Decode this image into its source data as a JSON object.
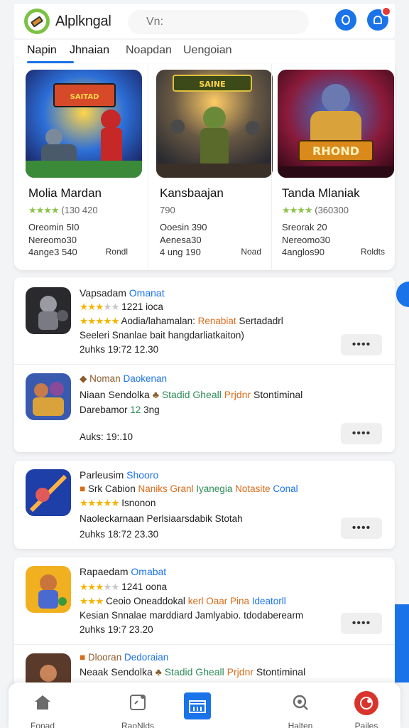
{
  "header": {
    "app_title": "Alplkngal",
    "search_placeholder": "Vn:"
  },
  "tabs": [
    {
      "label": "Napin"
    },
    {
      "label": "Jhnaian"
    },
    {
      "label": "Noapdan"
    },
    {
      "label": "Uengoian"
    }
  ],
  "featured": [
    {
      "title": "Molia Mardan",
      "rating_text": "4:4:4",
      "count": "(130 420",
      "stat1": "Oreomin 5I0",
      "stat2": "Nereomo30",
      "stat3": "4ange3 540",
      "right_label": "Rondl"
    },
    {
      "title": "Kansbaajan",
      "rating_text": "",
      "count": "790",
      "stat1": "Ooesin 390",
      "stat2": "Aenesa30",
      "stat3": "4 ung 190",
      "right_label": "Noad"
    },
    {
      "title": "Tanda Mlaniak",
      "rating_text": "3:4:4",
      "count": "(360300",
      "stat1": "Sreorak 20",
      "stat2": "Nereomo30",
      "stat3": "4anglos90",
      "right_label": "Roldts"
    }
  ],
  "featured_art": {
    "1": {
      "banner": "SAITAD"
    },
    "2": {
      "banner": "SAINE"
    },
    "3": {
      "banner": "RHOND"
    }
  },
  "list": {
    "card1": [
      {
        "title": "Vapsadam",
        "badge": "Omanat",
        "rating_count": "1221 ioca",
        "tags_a": "Aodia/lahamalan:",
        "tags_b": "Renabiat",
        "tags_c": "Sertadadrl",
        "desc": "Seeleri Snanlae bait hangdarliatkaiton)",
        "meta": "2uhks 19:72 12.30",
        "more": "••••"
      },
      {
        "title": "Noman",
        "badge": "Daokenan",
        "tag_line_a": "Niaan Sendolka",
        "tag_line_b": "Stadid Gheall",
        "tag_line_c": "Prjdnr",
        "tag_line_d": "Stontiminal",
        "sub": "Darebamor",
        "sub2": "12",
        "sub3": "3ng",
        "meta": "Auks: 19:.10",
        "more": "••••"
      }
    ],
    "card2": [
      {
        "title": "Parleusim",
        "badge": "Shooro",
        "tag_a": "Srk Cabion",
        "tag_b": "Naniks Granl",
        "tag_c": "Iyanegia",
        "tag_d": "Notasite",
        "tag_e": "Conal",
        "rating_count": "Isnonon",
        "desc": "Naoleckarnaan Perlsiaarsdabik Stotah",
        "meta": "2uhks 18:72 23.30",
        "more": "••••"
      }
    ],
    "card3": [
      {
        "title": "Rapaedam",
        "badge": "Omabat",
        "rating_count": "1241 oona",
        "tags_a": "Ceoio Oneaddokal",
        "tags_b": "kerl Oaar Pina",
        "tags_c": "Ideatorll",
        "desc": "Kesian Snnalae marddiard Jamlyabio. tdodaberearm",
        "meta": "2uhks 19:7 23.20",
        "more": "••••"
      },
      {
        "title": "Dlooran",
        "badge": "Dedoraian",
        "tag_line_a": "Neaak Sendolka",
        "tag_line_b": "Stadid Gheall",
        "tag_line_c": "Prjdnr",
        "tag_line_d": "Stontiminal"
      }
    ]
  },
  "bottom_nav": [
    {
      "label": "Fonad",
      "icon": "home-icon"
    },
    {
      "label": "RaoNlds",
      "icon": "apps-icon"
    },
    {
      "label": "",
      "icon": "store-icon"
    },
    {
      "label": "Halten",
      "icon": "search-icon"
    },
    {
      "label": "Pailes",
      "icon": "profile-icon"
    }
  ],
  "colors": {
    "accent": "#1a73e8",
    "logo_green": "#7cc242",
    "star_gold": "#f5b400",
    "star_green": "#8bc34a"
  }
}
